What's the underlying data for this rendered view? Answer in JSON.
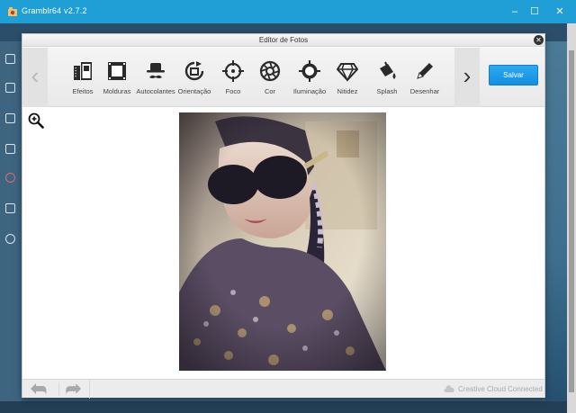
{
  "window": {
    "title": "Gramblr64 v2.7.2"
  },
  "dialog": {
    "title": "Editor de Fotos",
    "save_label": "Salvar",
    "tools": [
      {
        "label": "Efeitos",
        "icon": "effects-icon"
      },
      {
        "label": "Molduras",
        "icon": "frames-icon"
      },
      {
        "label": "Autocolantes",
        "icon": "stickers-icon"
      },
      {
        "label": "Orientação",
        "icon": "orientation-icon"
      },
      {
        "label": "Foco",
        "icon": "focus-icon"
      },
      {
        "label": "Cor",
        "icon": "color-icon"
      },
      {
        "label": "Iluminação",
        "icon": "lighting-icon"
      },
      {
        "label": "Nitidez",
        "icon": "sharpness-icon"
      },
      {
        "label": "Splash",
        "icon": "splash-icon"
      },
      {
        "label": "Desenhar",
        "icon": "draw-icon"
      }
    ],
    "footer": {
      "cc_status": "Creative Cloud Connected"
    }
  },
  "colors": {
    "titlebar": "#1f9fd6",
    "save_button": "#1a9ae8",
    "panel": "#f2f2f2"
  }
}
